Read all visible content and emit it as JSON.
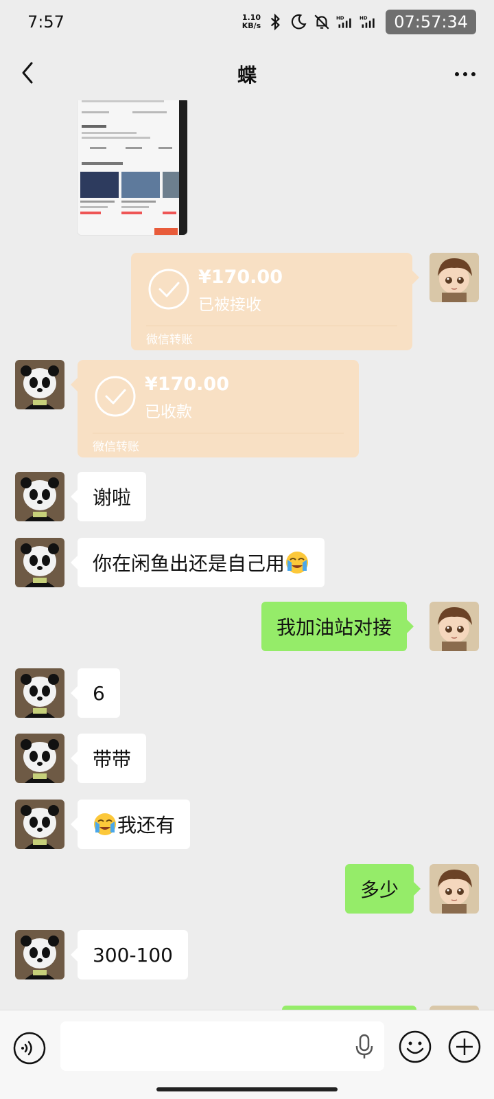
{
  "status_bar": {
    "time": "7:57",
    "net_speed_value": "1.10",
    "net_speed_unit": "KB/s",
    "overlay_clock": "07:57:34",
    "icons": [
      "bluetooth-icon",
      "moon-icon",
      "bell-off-icon",
      "hd-signal-icon",
      "hd-signal-icon",
      "wifi-icon"
    ]
  },
  "nav": {
    "title": "蝶",
    "back_icon": "chevron-left-icon",
    "more_icon": "more-dots-icon"
  },
  "messages": [
    {
      "side": "left",
      "type": "image",
      "description": "shared screenshot of gas station listing"
    },
    {
      "side": "right",
      "type": "transfer",
      "amount": "¥170.00",
      "status": "已被接收",
      "label": "微信转账"
    },
    {
      "side": "left",
      "type": "transfer",
      "amount": "¥170.00",
      "status": "已收款",
      "label": "微信转账"
    },
    {
      "side": "left",
      "type": "text",
      "text": "谢啦"
    },
    {
      "side": "left",
      "type": "text",
      "text": "你在闲鱼出还是自己用",
      "emoji": "crying-face-emoji"
    },
    {
      "side": "right",
      "type": "text",
      "text": "我加油站对接"
    },
    {
      "side": "left",
      "type": "text",
      "text": "6"
    },
    {
      "side": "left",
      "type": "text",
      "text": "带带"
    },
    {
      "side": "left",
      "type": "text",
      "text": "我还有",
      "emoji": "crying-face-emoji"
    },
    {
      "side": "right",
      "type": "text",
      "text": "多少"
    },
    {
      "side": "left",
      "type": "text",
      "text": "300-100"
    }
  ],
  "input_bar": {
    "placeholder": "",
    "value": ""
  },
  "colors": {
    "background": "#ededed",
    "right_bubble": "#95ec69",
    "left_bubble": "#ffffff",
    "transfer_card": "#f8e0c4"
  }
}
